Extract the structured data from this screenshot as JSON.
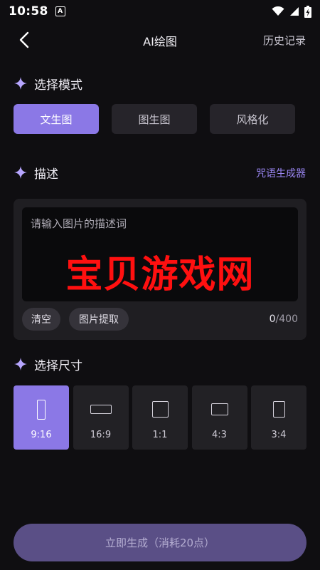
{
  "status_bar": {
    "time": "10:58",
    "notification": "A"
  },
  "header": {
    "title": "AI绘图",
    "history": "历史记录"
  },
  "mode_section": {
    "title": "选择模式",
    "options": [
      "文生图",
      "图生图",
      "风格化"
    ],
    "selected": "文生图"
  },
  "desc_section": {
    "title": "描述",
    "spell_link": "咒语生成器",
    "placeholder": "请输入图片的描述词",
    "watermark": "宝贝游戏网",
    "clear": "清空",
    "extract": "图片提取",
    "count_current": "0",
    "count_max": "/400"
  },
  "size_section": {
    "title": "选择尺寸",
    "options": [
      "9:16",
      "16:9",
      "1:1",
      "4:3",
      "3:4"
    ],
    "selected": "9:16"
  },
  "generate_button": "立即生成（消耗20点）",
  "colors": {
    "accent": "#8b78e6",
    "link": "#9a86f2",
    "generate_bg": "#5a4f86"
  }
}
